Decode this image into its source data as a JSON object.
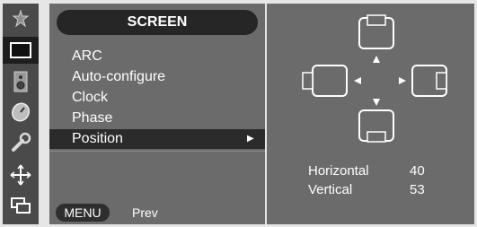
{
  "menu": {
    "title": "SCREEN",
    "items": [
      {
        "label": "ARC"
      },
      {
        "label": "Auto-configure"
      },
      {
        "label": "Clock"
      },
      {
        "label": "Phase"
      },
      {
        "label": "Position",
        "selected": true
      }
    ],
    "submenu_arrow": "▶",
    "footer": {
      "button_label": "MENU",
      "action_label": "Prev"
    }
  },
  "sidebar": {
    "icons": [
      {
        "name": "picture-icon"
      },
      {
        "name": "screen-icon",
        "active": true
      },
      {
        "name": "sound-icon"
      },
      {
        "name": "time-icon"
      },
      {
        "name": "setup-icon"
      },
      {
        "name": "position-icon"
      },
      {
        "name": "pip-icon"
      }
    ]
  },
  "position": {
    "horizontal": {
      "label": "Horizontal",
      "value": "40"
    },
    "vertical": {
      "label": "Vertical",
      "value": "53"
    }
  },
  "colors": {
    "panel": "#6b6b6b",
    "selected": "#2b2b2b",
    "text": "#ffffff"
  }
}
